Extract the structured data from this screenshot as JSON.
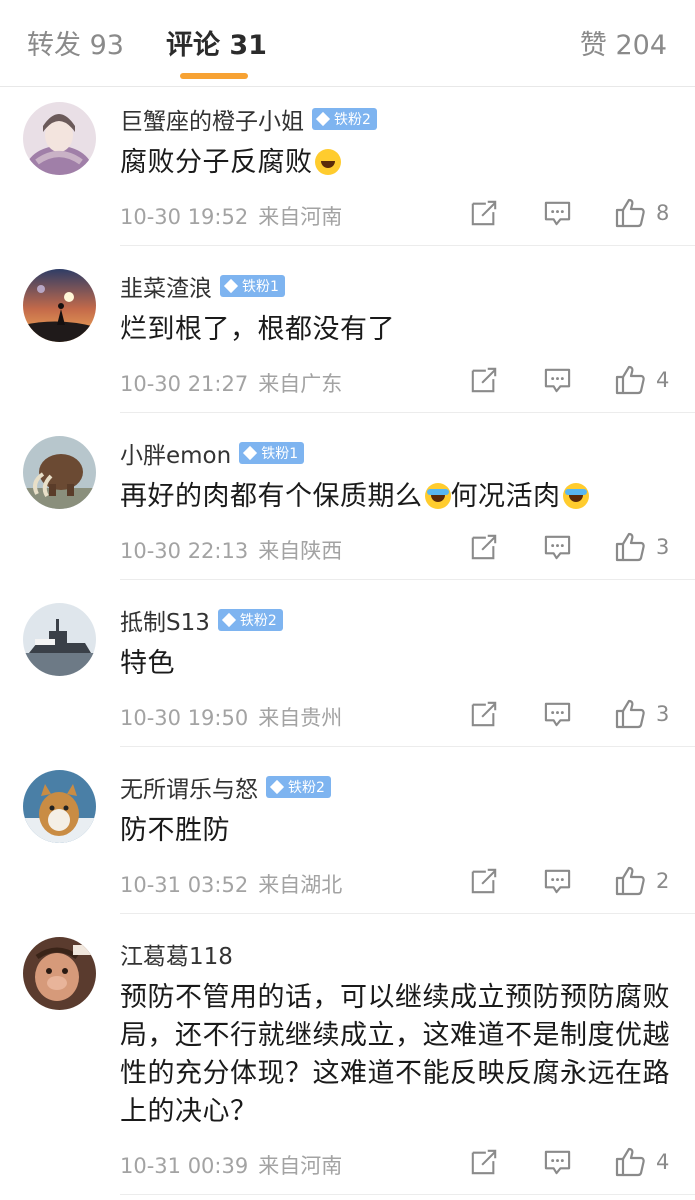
{
  "tabs": {
    "repost": "转发 93",
    "comments": "评论 31",
    "likes": "赞 204",
    "active": "comments",
    "accent_color": "#f7a233"
  },
  "comments": [
    {
      "username": "巨蟹座的橙子小姐",
      "badge": "铁粉2",
      "text": "腐败分子反腐败",
      "emoji": "grin-emoji",
      "time": "10-30 19:52",
      "location": "来自河南",
      "likes": "8"
    },
    {
      "username": "韭菜渣浪",
      "badge": "铁粉1",
      "text": "烂到根了，根都没有了",
      "time": "10-30 21:27",
      "location": "来自广东",
      "likes": "4"
    },
    {
      "username": "小胖emon",
      "badge": "铁粉1",
      "text_part1": "再好的肉都有个保质期么",
      "text_part2": "何况活肉",
      "emoji": "laugh-cry-emoji",
      "time": "10-30 22:13",
      "location": "来自陕西",
      "likes": "3"
    },
    {
      "username": "抵制S13",
      "badge": "铁粉2",
      "text": "特色",
      "time": "10-30 19:50",
      "location": "来自贵州",
      "likes": "3"
    },
    {
      "username": "无所谓乐与怒",
      "badge": "铁粉2",
      "text": "防不胜防",
      "time": "10-31 03:52",
      "location": "来自湖北",
      "likes": "2"
    },
    {
      "username": "江葛葛118",
      "text": "预防不管用的话，可以继续成立预防预防腐败局，还不行就继续成立，这难道不是制度优越性的充分体现？这难道不能反映反腐永远在路上的决心？",
      "time": "10-31 00:39",
      "location": "来自河南",
      "likes": "4"
    }
  ],
  "icons": {
    "repost": "share-icon",
    "reply": "comment-icon",
    "like": "thumbs-up-icon",
    "badge": "diamond-icon"
  },
  "colors": {
    "badge_bg": "#7eb4f0",
    "meta_text": "#a3a3a3"
  }
}
